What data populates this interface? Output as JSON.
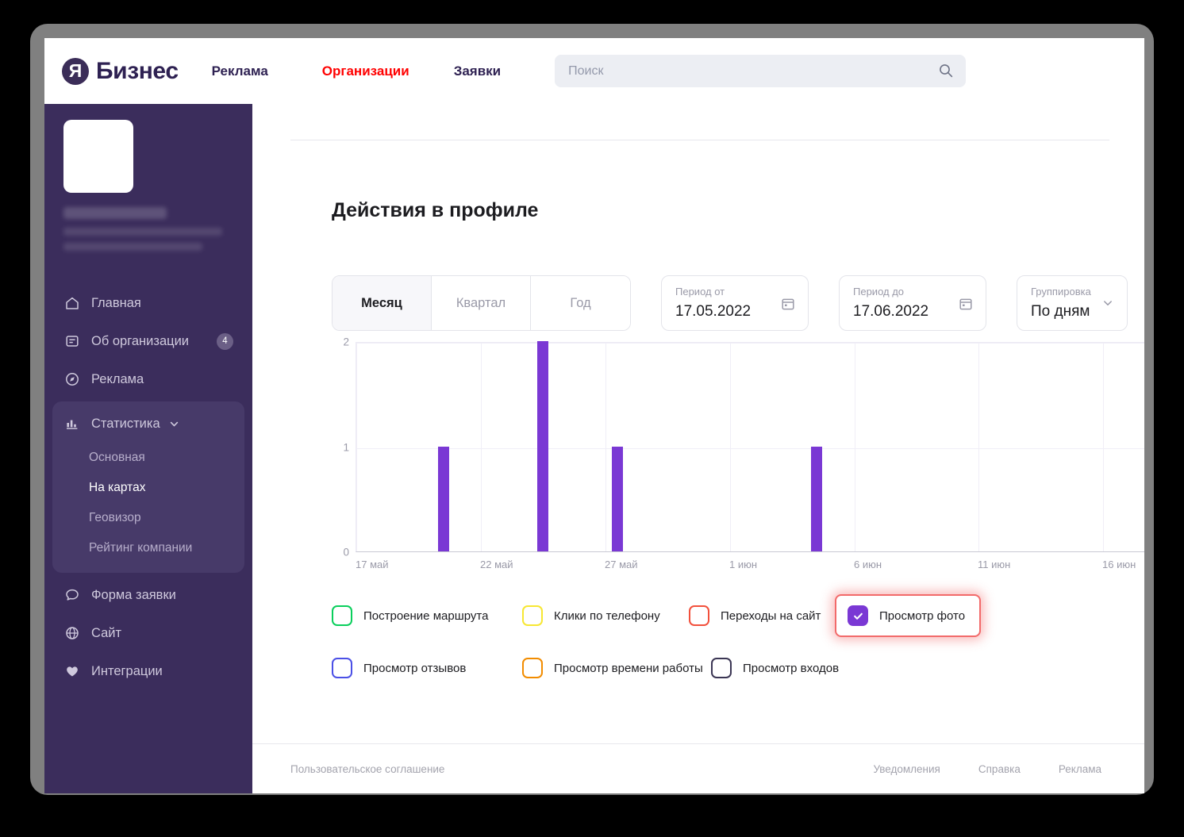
{
  "brand": {
    "logo_mark": "Я",
    "logo_text": "Бизнес",
    "accent_purple": "#7a38d4",
    "sidebar_bg": "#3b2d5c",
    "nav_active_color": "#ff0000"
  },
  "topnav": {
    "items": [
      {
        "label": "Реклама",
        "active": false
      },
      {
        "label": "Организации",
        "active": true
      },
      {
        "label": "Заявки",
        "active": false
      }
    ]
  },
  "search": {
    "placeholder": "Поиск",
    "value": "",
    "icon": "search-icon"
  },
  "sidebar": {
    "org_name": "",
    "org_address": "",
    "items": [
      {
        "label": "Главная",
        "icon": "home-icon",
        "badge": ""
      },
      {
        "label": "Об организации",
        "icon": "document-icon",
        "badge": "4"
      },
      {
        "label": "Реклама",
        "icon": "compass-icon",
        "badge": ""
      },
      {
        "label": "Статистика",
        "icon": "bar-chart-icon",
        "badge": "",
        "expanded": true
      },
      {
        "label": "Форма заявки",
        "icon": "chat-icon",
        "badge": ""
      },
      {
        "label": "Сайт",
        "icon": "globe-icon",
        "badge": ""
      },
      {
        "label": "Интеграции",
        "icon": "heart-icon",
        "badge": ""
      }
    ],
    "stats_submenu": [
      {
        "label": "Основная",
        "active": false
      },
      {
        "label": "На картах",
        "active": true
      },
      {
        "label": "Геовизор",
        "active": false
      },
      {
        "label": "Рейтинг компании",
        "active": false
      }
    ]
  },
  "main": {
    "page_title": "Действия в профиле",
    "period_tabs": [
      {
        "label": "Месяц",
        "active": true
      },
      {
        "label": "Квартал",
        "active": false
      },
      {
        "label": "Год",
        "active": false
      }
    ],
    "date_from": {
      "label": "Период от",
      "value": "17.05.2022",
      "icon": "calendar-icon"
    },
    "date_to": {
      "label": "Период до",
      "value": "17.06.2022",
      "icon": "calendar-icon"
    },
    "grouping": {
      "label": "Группировка",
      "value": "По дням",
      "icon": "chevron-down-icon"
    }
  },
  "chart_data": {
    "type": "bar",
    "title": "Действия в профиле",
    "xlabel": "",
    "ylabel": "",
    "ylim": [
      0,
      2
    ],
    "yticks": [
      0,
      1,
      2
    ],
    "grid": true,
    "legend_position": "bottom",
    "bar_color": "#7a38d4",
    "categories": [
      "17 май",
      "18 май",
      "19 май",
      "20 май",
      "21 май",
      "22 май",
      "23 май",
      "24 май",
      "25 май",
      "26 май",
      "27 май",
      "28 май",
      "29 май",
      "30 май",
      "31 май",
      "1 июн",
      "2 июн",
      "3 июн",
      "4 июн",
      "5 июн",
      "6 июн",
      "7 июн",
      "8 июн",
      "9 июн",
      "10 июн",
      "11 июн",
      "12 июн",
      "13 июн",
      "14 июн",
      "15 июн",
      "16 июн",
      "17 июн"
    ],
    "series": [
      {
        "name": "Просмотр фото",
        "color": "#7a38d4",
        "values": [
          0,
          0,
          0,
          1,
          0,
          0,
          0,
          2,
          0,
          0,
          1,
          0,
          0,
          0,
          0,
          0,
          0,
          0,
          1,
          0,
          0,
          0,
          0,
          0,
          0,
          0,
          0,
          0,
          0,
          0,
          0,
          0
        ]
      }
    ],
    "xtick_labels": [
      "17 май",
      "22 май",
      "27 май",
      "1 июн",
      "6 июн",
      "11 июн",
      "16 июн"
    ],
    "xtick_indices": [
      0,
      5,
      10,
      15,
      20,
      25,
      30
    ]
  },
  "legend": {
    "rows": [
      [
        {
          "label": "Построение маршрута",
          "color": "#0ACF5C",
          "checked": false,
          "highlighted": false
        },
        {
          "label": "Клики по телефону",
          "color": "#F7E733",
          "checked": false,
          "highlighted": false
        },
        {
          "label": "Переходы на сайт",
          "color": "#F2503C",
          "checked": false,
          "highlighted": false
        },
        {
          "label": "Просмотр фото",
          "color": "#7a38d4",
          "checked": true,
          "highlighted": true
        }
      ],
      [
        {
          "label": "Просмотр отзывов",
          "color": "#4B50E6",
          "checked": false,
          "highlighted": false
        },
        {
          "label": "Просмотр времени работы",
          "color": "#F28C00",
          "checked": false,
          "highlighted": false
        },
        {
          "label": "Просмотр входов",
          "color": "#3B3654",
          "checked": false,
          "highlighted": false
        }
      ]
    ]
  },
  "footer": {
    "agreement": "Пользовательское соглашение",
    "links": [
      "Уведомления",
      "Справка",
      "Реклама"
    ]
  }
}
